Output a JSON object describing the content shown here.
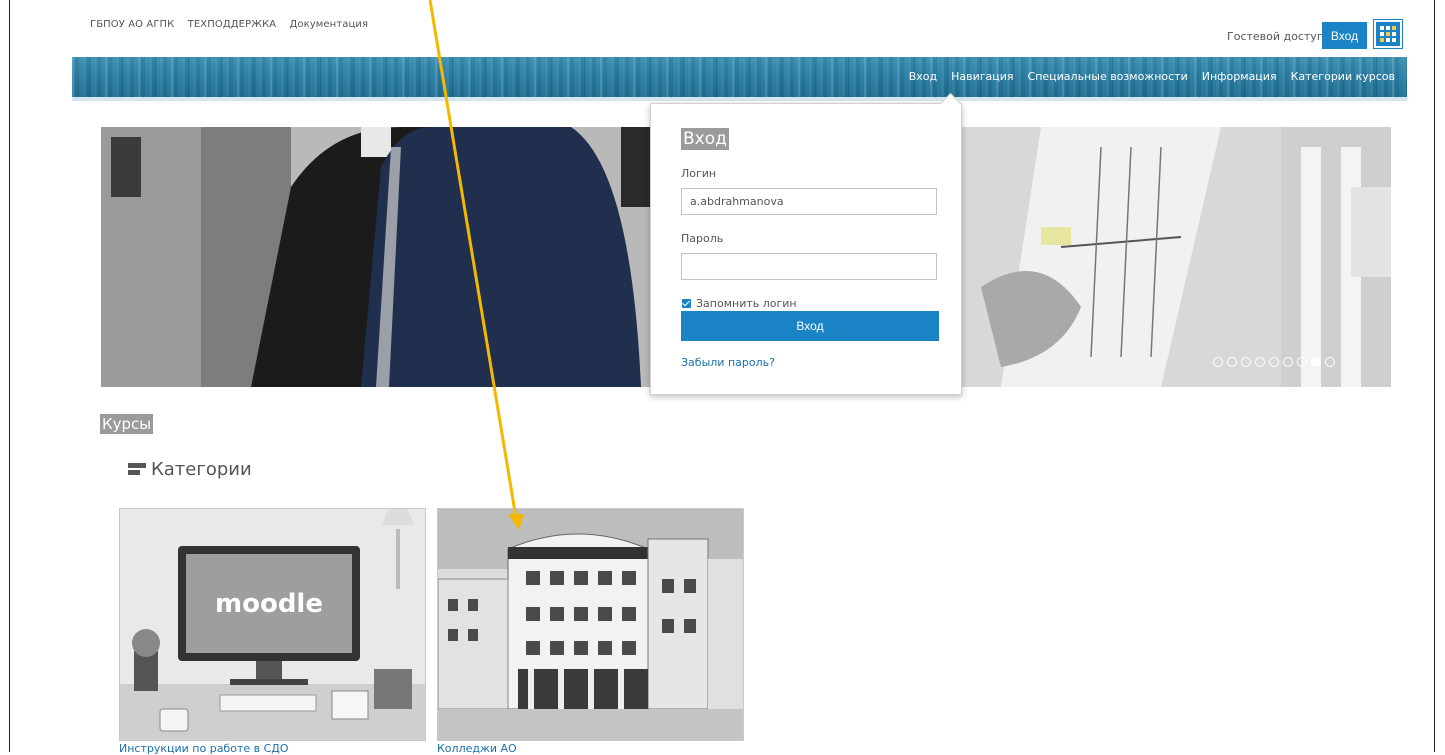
{
  "top_links": [
    "ГБПОУ АО АГПК",
    "ТЕХПОДДЕРЖКА",
    "Документация"
  ],
  "header": {
    "guest_access": "Гостевой доступ",
    "login_button": "Вход"
  },
  "nav": [
    "Вход",
    "Навигация",
    "Специальные возможности",
    "Информация",
    "Категории курсов"
  ],
  "login_popup": {
    "title": "Вход",
    "username_label": "Логин",
    "username_value": "a.abdrahmanova",
    "password_label": "Пароль",
    "password_value": "",
    "remember_label": "Запомнить логин",
    "remember_checked": true,
    "submit_label": "Вход",
    "forgot_link": "Забыли пароль?"
  },
  "slider": {
    "dot_count": 9,
    "active_dot": 7
  },
  "main": {
    "courses_title": "Курсы",
    "categories_title": "Категории",
    "cards": [
      {
        "label": "Инструкции по работе в СДО",
        "image_text": "moodle"
      },
      {
        "label": "Колледжи АО"
      }
    ]
  },
  "annotation": {
    "arrow_color": "#f5b800"
  },
  "colors": {
    "accent": "#1a83c6",
    "link": "#1a6faa"
  }
}
